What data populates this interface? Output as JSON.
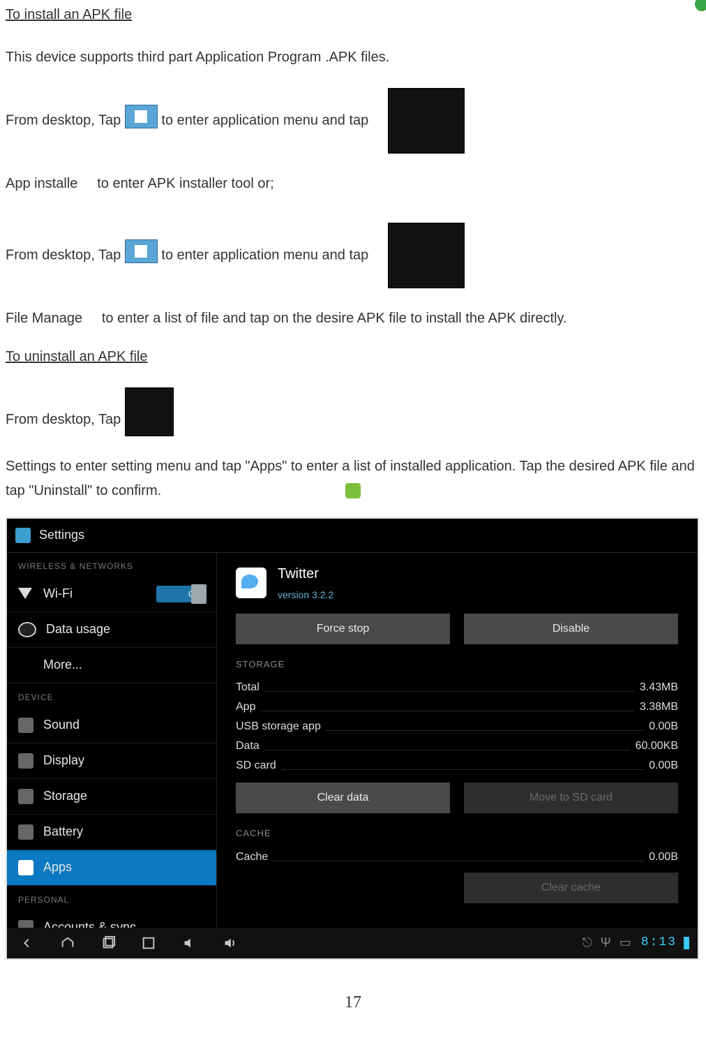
{
  "doc": {
    "heading_install": "To install an APK file",
    "intro": "This device supports third part Application Program .APK files.",
    "line1_a": "From desktop, Tap ",
    "line1_b": " to enter application menu and tap",
    "line1_c": "to enter APK installer tool or;",
    "app_installer_label": "App installe",
    "line2_a": "From desktop, Tap ",
    "line2_b": " to enter application menu and tap",
    "line2_c": "to enter a list of file and tap on the desire APK file to install the APK directly.",
    "file_manager_label": "File Manage",
    "heading_uninstall": "To uninstall an APK file",
    "line3_a": "From desktop, Tap ",
    "settings_label": "Settings",
    "line3_b": " to enter setting menu and tap \"Apps\" to enter a list of installed application.   Tap the desired APK file and tap \"Uninstall\" to confirm.",
    "page_number": "17"
  },
  "shot": {
    "title": "Settings",
    "sections": {
      "wireless": "WIRELESS & NETWORKS",
      "device": "DEVICE",
      "personal": "PERSONAL"
    },
    "sidebar": {
      "wifi": "Wi-Fi",
      "wifi_toggle": "ON",
      "data_usage": "Data usage",
      "more": "More...",
      "sound": "Sound",
      "display": "Display",
      "storage": "Storage",
      "battery": "Battery",
      "apps": "Apps",
      "accounts": "Accounts & sync"
    },
    "app": {
      "name": "Twitter",
      "version": "version 3.2.2",
      "force_stop": "Force stop",
      "disable": "Disable",
      "storage_header": "STORAGE",
      "rows": {
        "total_k": "Total",
        "total_v": "3.43MB",
        "app_k": "App",
        "app_v": "3.38MB",
        "usb_k": "USB storage app",
        "usb_v": "0.00B",
        "data_k": "Data",
        "data_v": "60.00KB",
        "sd_k": "SD card",
        "sd_v": "0.00B"
      },
      "clear_data": "Clear data",
      "move_sd": "Move to SD card",
      "cache_header": "CACHE",
      "cache_k": "Cache",
      "cache_v": "0.00B",
      "clear_cache": "Clear cache"
    },
    "status": {
      "clock": "8:13"
    }
  }
}
